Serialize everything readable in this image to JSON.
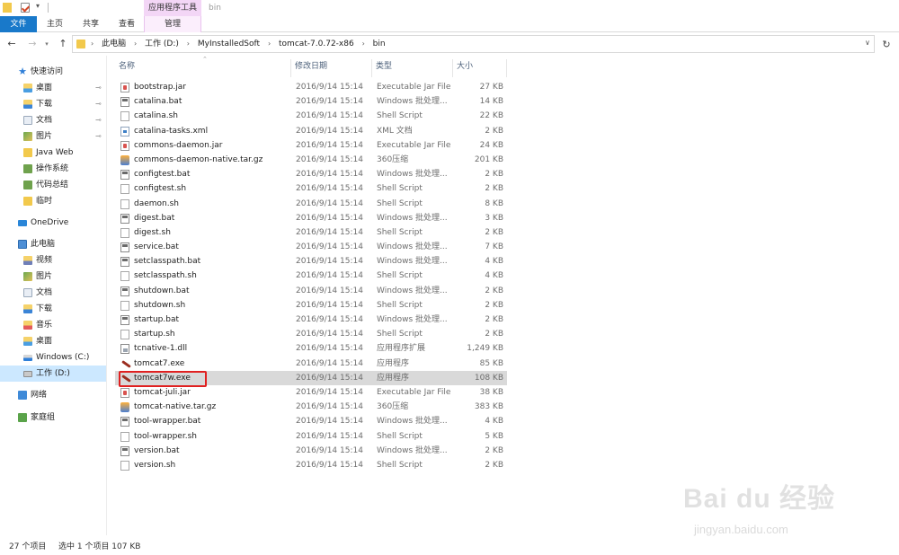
{
  "window": {
    "title": "bin",
    "tool_tab_title": "应用程序工具"
  },
  "ribbon": {
    "tabs": [
      "文件",
      "主页",
      "共享",
      "查看",
      "管理"
    ]
  },
  "address": {
    "crumbs": [
      "此电脑",
      "工作 (D:)",
      "MyInstalledSoft",
      "tomcat-7.0.72-x86",
      "bin"
    ]
  },
  "navigation": {
    "quick_access": "快速访问",
    "quick_items": [
      {
        "label": "桌面",
        "pinned": true
      },
      {
        "label": "下载",
        "pinned": true
      },
      {
        "label": "文档",
        "pinned": true
      },
      {
        "label": "图片",
        "pinned": true
      },
      {
        "label": "Java Web",
        "pinned": false
      },
      {
        "label": "操作系统",
        "pinned": false
      },
      {
        "label": "代码总结",
        "pinned": false
      },
      {
        "label": "临时",
        "pinned": false
      }
    ],
    "onedrive": "OneDrive",
    "this_pc": "此电脑",
    "pc_items": [
      "视频",
      "图片",
      "文档",
      "下载",
      "音乐",
      "桌面",
      "Windows (C:)",
      "工作 (D:)"
    ],
    "network": "网络",
    "homegroup": "家庭组",
    "pin_glyph": "📌"
  },
  "columns": {
    "name": "名称",
    "date": "修改日期",
    "type": "类型",
    "size": "大小"
  },
  "files": [
    {
      "name": "bootstrap.jar",
      "date": "2016/9/14 15:14",
      "type": "Executable Jar File",
      "size": "27 KB",
      "icon": "jar"
    },
    {
      "name": "catalina.bat",
      "date": "2016/9/14 15:14",
      "type": "Windows 批处理...",
      "size": "14 KB",
      "icon": "bat"
    },
    {
      "name": "catalina.sh",
      "date": "2016/9/14 15:14",
      "type": "Shell Script",
      "size": "22 KB",
      "icon": "sh"
    },
    {
      "name": "catalina-tasks.xml",
      "date": "2016/9/14 15:14",
      "type": "XML 文档",
      "size": "2 KB",
      "icon": "xml"
    },
    {
      "name": "commons-daemon.jar",
      "date": "2016/9/14 15:14",
      "type": "Executable Jar File",
      "size": "24 KB",
      "icon": "jar"
    },
    {
      "name": "commons-daemon-native.tar.gz",
      "date": "2016/9/14 15:14",
      "type": "360压缩",
      "size": "201 KB",
      "icon": "gz"
    },
    {
      "name": "configtest.bat",
      "date": "2016/9/14 15:14",
      "type": "Windows 批处理...",
      "size": "2 KB",
      "icon": "bat"
    },
    {
      "name": "configtest.sh",
      "date": "2016/9/14 15:14",
      "type": "Shell Script",
      "size": "2 KB",
      "icon": "sh"
    },
    {
      "name": "daemon.sh",
      "date": "2016/9/14 15:14",
      "type": "Shell Script",
      "size": "8 KB",
      "icon": "sh"
    },
    {
      "name": "digest.bat",
      "date": "2016/9/14 15:14",
      "type": "Windows 批处理...",
      "size": "3 KB",
      "icon": "bat"
    },
    {
      "name": "digest.sh",
      "date": "2016/9/14 15:14",
      "type": "Shell Script",
      "size": "2 KB",
      "icon": "sh"
    },
    {
      "name": "service.bat",
      "date": "2016/9/14 15:14",
      "type": "Windows 批处理...",
      "size": "7 KB",
      "icon": "bat"
    },
    {
      "name": "setclasspath.bat",
      "date": "2016/9/14 15:14",
      "type": "Windows 批处理...",
      "size": "4 KB",
      "icon": "bat"
    },
    {
      "name": "setclasspath.sh",
      "date": "2016/9/14 15:14",
      "type": "Shell Script",
      "size": "4 KB",
      "icon": "sh"
    },
    {
      "name": "shutdown.bat",
      "date": "2016/9/14 15:14",
      "type": "Windows 批处理...",
      "size": "2 KB",
      "icon": "bat"
    },
    {
      "name": "shutdown.sh",
      "date": "2016/9/14 15:14",
      "type": "Shell Script",
      "size": "2 KB",
      "icon": "sh"
    },
    {
      "name": "startup.bat",
      "date": "2016/9/14 15:14",
      "type": "Windows 批处理...",
      "size": "2 KB",
      "icon": "bat"
    },
    {
      "name": "startup.sh",
      "date": "2016/9/14 15:14",
      "type": "Shell Script",
      "size": "2 KB",
      "icon": "sh"
    },
    {
      "name": "tcnative-1.dll",
      "date": "2016/9/14 15:14",
      "type": "应用程序扩展",
      "size": "1,249 KB",
      "icon": "dll"
    },
    {
      "name": "tomcat7.exe",
      "date": "2016/9/14 15:14",
      "type": "应用程序",
      "size": "85 KB",
      "icon": "exe"
    },
    {
      "name": "tomcat7w.exe",
      "date": "2016/9/14 15:14",
      "type": "应用程序",
      "size": "108 KB",
      "icon": "exe",
      "selected": true
    },
    {
      "name": "tomcat-juli.jar",
      "date": "2016/9/14 15:14",
      "type": "Executable Jar File",
      "size": "38 KB",
      "icon": "jar"
    },
    {
      "name": "tomcat-native.tar.gz",
      "date": "2016/9/14 15:14",
      "type": "360压缩",
      "size": "383 KB",
      "icon": "gz"
    },
    {
      "name": "tool-wrapper.bat",
      "date": "2016/9/14 15:14",
      "type": "Windows 批处理...",
      "size": "4 KB",
      "icon": "bat"
    },
    {
      "name": "tool-wrapper.sh",
      "date": "2016/9/14 15:14",
      "type": "Shell Script",
      "size": "5 KB",
      "icon": "sh"
    },
    {
      "name": "version.bat",
      "date": "2016/9/14 15:14",
      "type": "Windows 批处理...",
      "size": "2 KB",
      "icon": "bat"
    },
    {
      "name": "version.sh",
      "date": "2016/9/14 15:14",
      "type": "Shell Script",
      "size": "2 KB",
      "icon": "sh"
    }
  ],
  "status": {
    "count": "27 个项目",
    "selection": "选中 1 个项目  107 KB"
  },
  "watermark": {
    "logo": "Bai du 经验",
    "url": "jingyan.baidu.com"
  },
  "colors": {
    "file_tab": "#1979ca",
    "manage_tab": "#f3d6f6",
    "selection": "#cce8ff",
    "highlight_box": "#e02020"
  }
}
